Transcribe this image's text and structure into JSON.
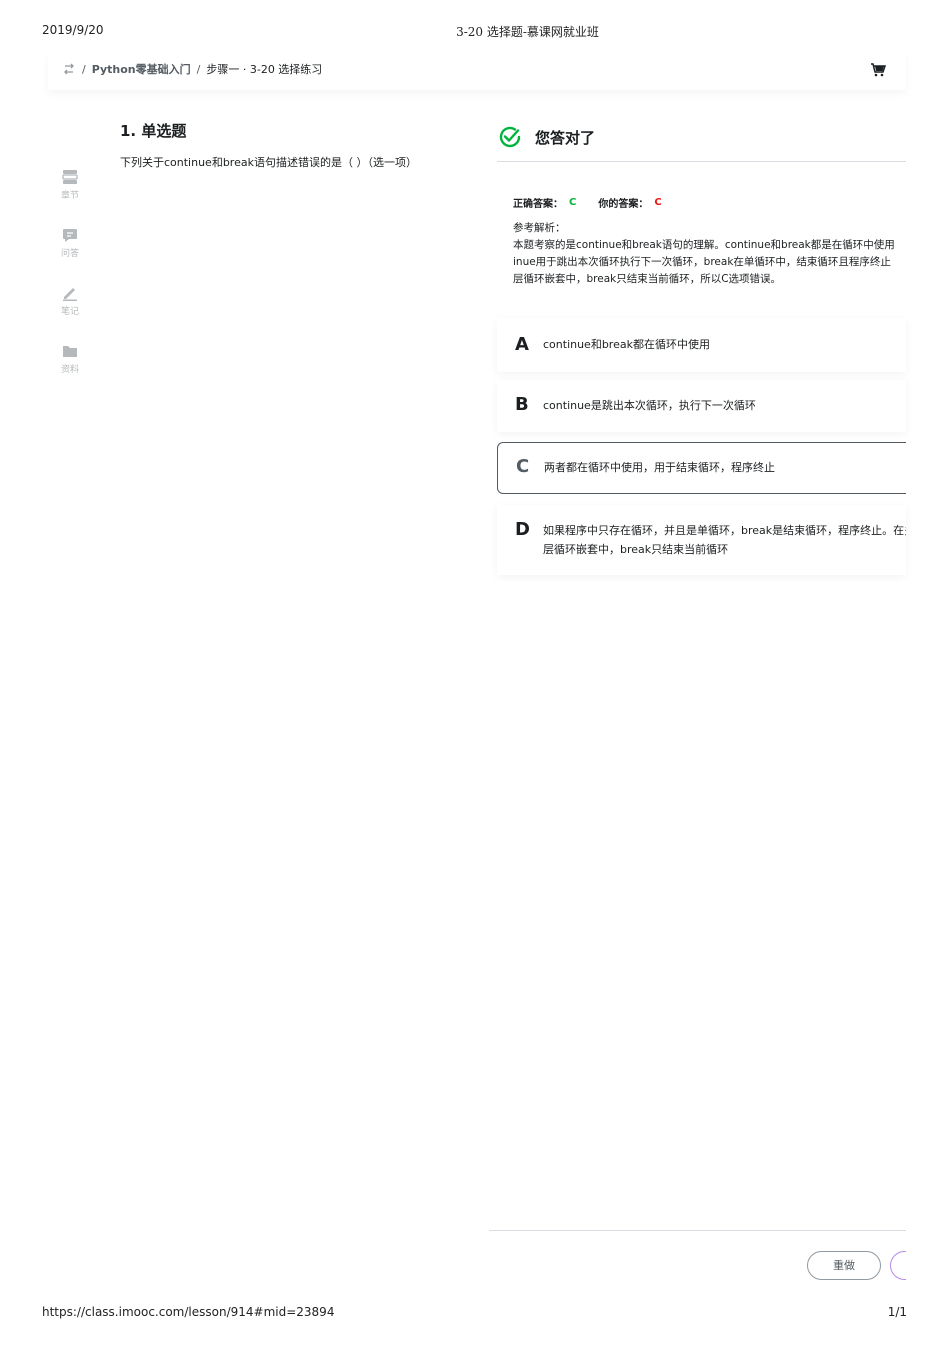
{
  "print_header": {
    "date": "2019/9/20",
    "title": "3-20 选择题-慕课网就业班"
  },
  "print_footer": {
    "url": "https://class.imooc.com/lesson/914#mid=23894",
    "page": "1/1"
  },
  "breadcrumb": {
    "separator": "/",
    "course": "Python零基础入门",
    "step": "步骤一 · 3-20 选择练习"
  },
  "sidebar": {
    "items": [
      {
        "label": "章节",
        "icon": "chapter-icon"
      },
      {
        "label": "问答",
        "icon": "qa-icon"
      },
      {
        "label": "笔记",
        "icon": "note-icon"
      },
      {
        "label": "资料",
        "icon": "folder-icon"
      }
    ]
  },
  "question": {
    "title": "1. 单选题",
    "text": "下列关于continue和break语句描述错误的是（ ）（选一项）"
  },
  "result": {
    "title": "您答对了",
    "correct_label": "正确答案：",
    "correct_value": "C",
    "user_label": "你的答案：",
    "user_value": "C",
    "analysis_label": "参考解析：",
    "analysis_lines": [
      "本题考察的是continue和break语句的理解。continue和break都是在循环中使用",
      "inue用于跳出本次循环执行下一次循环，break在单循环中，结束循环且程序终止",
      "层循环嵌套中，break只结束当前循环，所以C选项错误。"
    ]
  },
  "options": [
    {
      "letter": "A",
      "text": "continue和break都在循环中使用"
    },
    {
      "letter": "B",
      "text": "continue是跳出本次循环，执行下一次循环"
    },
    {
      "letter": "C",
      "text": "两者都在循环中使用，用于结束循环，程序终止"
    },
    {
      "letter": "D",
      "text": "如果程序中只存在循环，并且是单循环，break是结束循环，程序终止。在多层循环嵌套中，break只结束当前循环"
    }
  ],
  "actions": {
    "redo": "重做"
  },
  "colors": {
    "correct": "#00b43c",
    "wrong": "#f01414",
    "selected_border": "#545c63",
    "sidebar_icon": "#b5b9bc"
  }
}
